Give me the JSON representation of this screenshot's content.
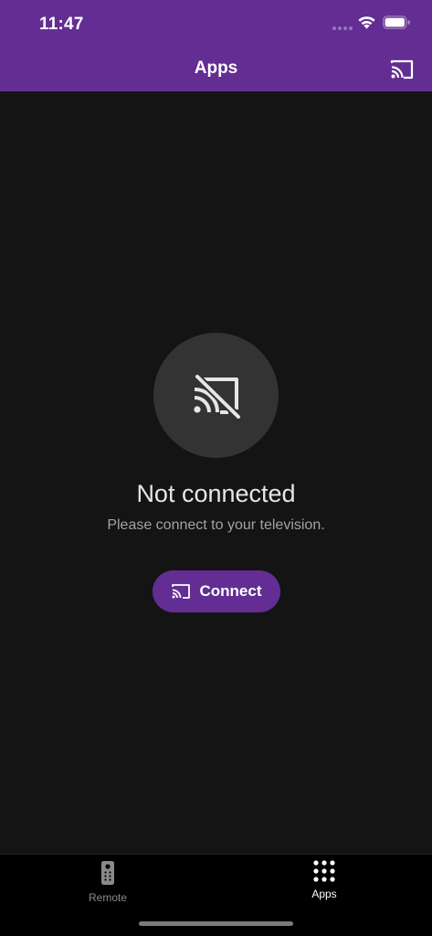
{
  "status_bar": {
    "time": "11:47"
  },
  "header": {
    "title": "Apps",
    "cast_icon": "cast-icon"
  },
  "empty_state": {
    "icon": "cast-disconnected-icon",
    "title": "Not connected",
    "subtitle": "Please connect to your television.",
    "button_label": "Connect",
    "button_icon": "cast-icon"
  },
  "tabs": [
    {
      "label": "Remote",
      "icon": "remote-icon",
      "active": false
    },
    {
      "label": "Apps",
      "icon": "apps-grid-icon",
      "active": true
    }
  ],
  "colors": {
    "brand": "#632d94",
    "background": "#141414",
    "circle": "#333333",
    "tab_bar": "#000000"
  }
}
